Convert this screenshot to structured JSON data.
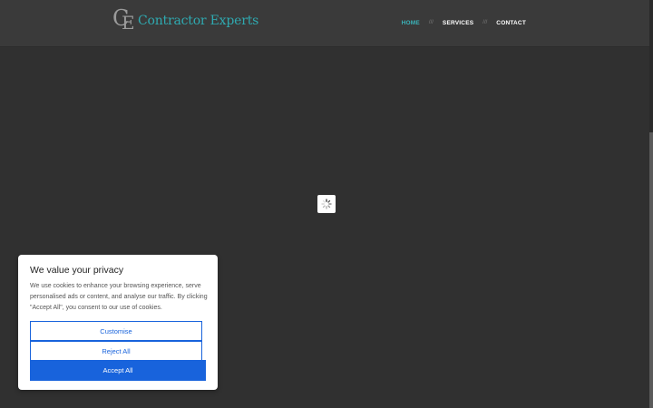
{
  "header": {
    "logo_mark": {
      "c": "C",
      "e": "E"
    },
    "logo_text": "Contractor Experts",
    "nav": [
      {
        "label": "HOME"
      },
      {
        "label": "SERVICES"
      },
      {
        "label": "CONTACT"
      }
    ],
    "nav_separator": "///"
  },
  "cookie_banner": {
    "title": "We value your privacy",
    "text": "We use cookies to enhance your browsing experience, serve personalised ads or content, and analyse our traffic. By clicking \"Accept All\", you consent to our use of cookies.",
    "customise_label": "Customise",
    "reject_label": "Reject All",
    "accept_label": "Accept All"
  },
  "colors": {
    "background": "#303030",
    "header": "#3a3a3a",
    "accent": "#3ab3b9",
    "button_blue": "#1863dc"
  },
  "icons": {
    "loader": "spinner-icon"
  }
}
